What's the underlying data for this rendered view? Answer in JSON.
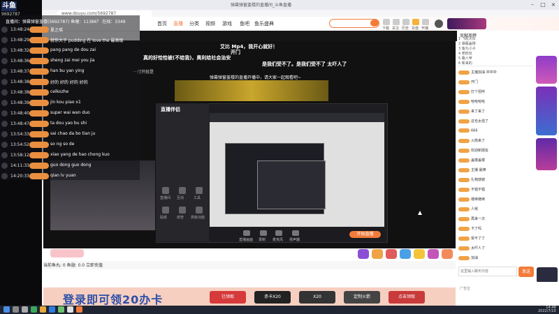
{
  "overlay": {
    "logo": "斗鱼",
    "room_num": "9692787",
    "header_line": "直播间：弹幕弹窗盖楼(5692787) 鱼塘：11386？ 在线：3349",
    "rows": [
      {
        "time": "13:48:24",
        "text": "夏之瑶"
      },
      {
        "time": "13:48:29",
        "text": "就你大于 pudding 在 love the 最高级"
      },
      {
        "time": "13:48:32",
        "text": "pang pang de dou zai"
      },
      {
        "time": "13:48:36",
        "text": "sheng zai mei you jia"
      },
      {
        "time": "13:48:37",
        "text": "han bu yan ying"
      },
      {
        "time": "13:48:38",
        "text": "好的 好的 好的 好的"
      },
      {
        "time": "13:48:38",
        "text": "celkozhe"
      },
      {
        "time": "13:48:39",
        "text": "jin kou piao x1"
      },
      {
        "time": "13:48:40",
        "text": "super wai wan duo"
      },
      {
        "time": "13:48:47",
        "text": "ta dou yao bu shi"
      },
      {
        "time": "13:54:33",
        "text": "sai chao da bo tian ju"
      },
      {
        "time": "13:54:52",
        "text": "so ng so de"
      },
      {
        "time": "13:58:12",
        "text": "xiao yang de hao chong kuo"
      },
      {
        "time": "14:11:33",
        "text": "guo dong guo dong"
      },
      {
        "time": "14:20:33",
        "text": "qian lv yuan"
      }
    ]
  },
  "browser": {
    "tab_title": "弹幕弹窗盖楼的直播间_斗鱼直播",
    "url": "www.douyu.com/5692787",
    "nav": [
      "首页",
      "直播",
      "分类",
      "视频",
      "游戏",
      "鱼吧",
      "鱼乐盛典"
    ],
    "nav_icons": [
      "下载",
      "关注",
      "历史",
      "充值",
      "开播"
    ],
    "danmu": [
      "艾比 Mp4，我开心就好！",
      "开门",
      "真的好恰恰被(不给我)，奥利给社会治安",
      "是我们受不了。是我们受不了 太吓人了",
      "一打开就是",
      "弹幕弹窗盖楼的直播开播中，请大家一起观看吧~"
    ],
    "tool": {
      "logo": "直播伴侣",
      "side_items": [
        "直播间",
        "互动",
        "工具",
        "贴纸",
        "房管",
        "高级功能"
      ],
      "bottom_buttons": [
        "直播画面",
        "录制",
        "麦克风",
        "扬声器",
        "开始直播"
      ],
      "start_label": "开始直播"
    },
    "gift_bar": "当前鱼丸: 0 鱼翅: 0.0 立即充值",
    "ad": {
      "text": "登录即可领20办卡",
      "cards": [
        "已领取",
        "赤卡X20",
        "X20",
        "定制火箭",
        "点击领取"
      ]
    }
  },
  "right_panel": {
    "rank_title": "贡献周榜",
    "rank_rows": [
      "1 飞机大队",
      "2 弹幕盖楼",
      "3 鱼丸小子",
      "4 老粉丝",
      "5 路人甲",
      "6 新来的"
    ],
    "chat": [
      "主播加油 冲冲冲",
      "开门",
      "打个招呼",
      "哈哈哈哈",
      "来了来了",
      "这也太强了",
      "666",
      "火箭来了",
      "欢迎新朋友",
      "盖楼盖楼",
      "主播 最棒",
      "礼物感谢",
      "不错不错",
      "继续继续",
      "人呢",
      "再来一次",
      "卡了吗",
      "受不了了",
      "太吓人了",
      "加油"
    ],
    "input_placeholder": "这里输入聊天内容",
    "send_label": "发送",
    "bottom_label": "广告位"
  },
  "taskbar": {
    "time": "14:48",
    "date": "2022/7/10"
  },
  "colors": {
    "brand_orange": "#f37b3a",
    "accent_blue": "#2c4fa8",
    "dark": "#111111"
  }
}
